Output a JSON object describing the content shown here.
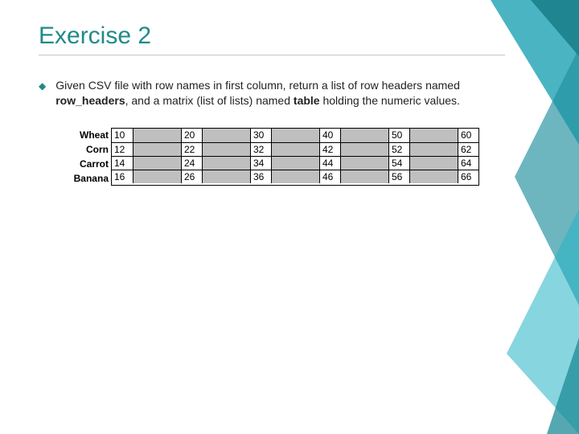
{
  "title": "Exercise 2",
  "body_parts": {
    "p1": "Given CSV file with row names in first column, return a list of row headers named ",
    "b1": "row_headers",
    "p2": ", and a matrix (list of lists) named ",
    "b2": "table",
    "p3": " holding the numeric values."
  },
  "row_headers": [
    "Wheat",
    "Corn",
    "Carrot",
    "Banana"
  ],
  "table": [
    [
      "10",
      "",
      "20",
      "",
      "30",
      "",
      "40",
      "",
      "50",
      "",
      "60"
    ],
    [
      "12",
      "",
      "22",
      "",
      "32",
      "",
      "42",
      "",
      "52",
      "",
      "62"
    ],
    [
      "14",
      "",
      "24",
      "",
      "34",
      "",
      "44",
      "",
      "54",
      "",
      "64"
    ],
    [
      "16",
      "",
      "26",
      "",
      "36",
      "",
      "46",
      "",
      "56",
      "",
      "66"
    ]
  ]
}
